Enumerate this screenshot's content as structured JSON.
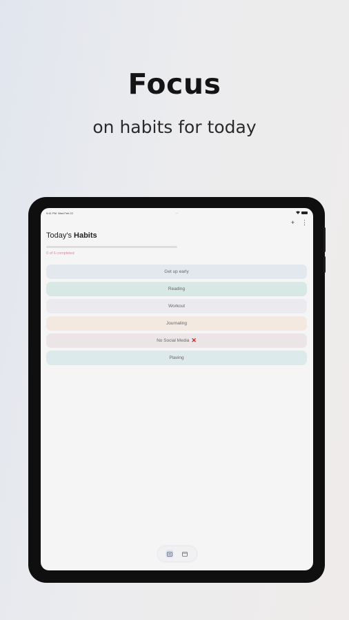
{
  "headline": "Focus",
  "subheadline": "on habits for today",
  "statusbar": {
    "time": "9:41 PM",
    "date": "Wed Feb 22",
    "url": "···"
  },
  "header": {
    "title_prefix": "Today's",
    "title_bold": "Habits",
    "add_label": "+",
    "menu_label": "⋮"
  },
  "progress": {
    "completed": 0,
    "total": 6,
    "fraction": 0,
    "label": "0 of 6 completed",
    "color": "#c88ea4"
  },
  "habits": [
    {
      "label": "Get up early",
      "color": "#e3e8ef"
    },
    {
      "label": "Reading",
      "color": "#d8e8e5"
    },
    {
      "label": "Workout",
      "color": "#ebebef"
    },
    {
      "label": "Journaling",
      "color": "#f3e9e1"
    },
    {
      "label": "No Social Media",
      "color": "#ebe5e7",
      "mark": "✕",
      "mark_color": "#d21f1f"
    },
    {
      "label": "Plaving",
      "color": "#dceaec"
    }
  ],
  "bottom_nav": {
    "items": [
      {
        "icon": "list-icon",
        "active": true
      },
      {
        "icon": "calendar-icon",
        "active": false
      }
    ]
  }
}
